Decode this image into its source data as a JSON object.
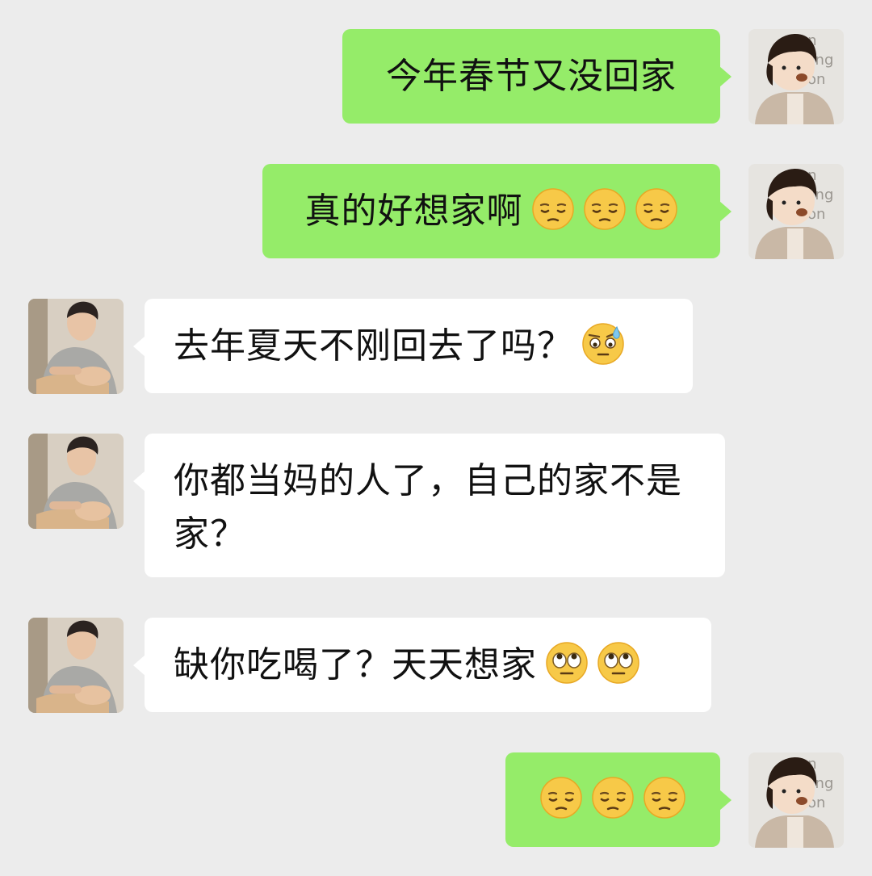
{
  "messages": [
    {
      "side": "me",
      "text": "今年春节又没回家",
      "emojis": []
    },
    {
      "side": "me",
      "text": "真的好想家啊",
      "emojis": [
        "pensive-face",
        "pensive-face",
        "pensive-face"
      ]
    },
    {
      "side": "other",
      "text": "去年夏天不刚回去了吗？",
      "emojis": [
        "sweat-face"
      ]
    },
    {
      "side": "other",
      "text": "你都当妈的人了，自己的家不是家？",
      "emojis": []
    },
    {
      "side": "other",
      "text": "缺你吃喝了？天天想家",
      "emojis": [
        "eye-roll-face",
        "eye-roll-face"
      ]
    },
    {
      "side": "me",
      "text": "",
      "emojis": [
        "pensive-face",
        "pensive-face",
        "pensive-face"
      ]
    }
  ],
  "colors": {
    "background": "#ececec",
    "me_bubble": "#95ec69",
    "other_bubble": "#ffffff",
    "text": "#111111"
  }
}
